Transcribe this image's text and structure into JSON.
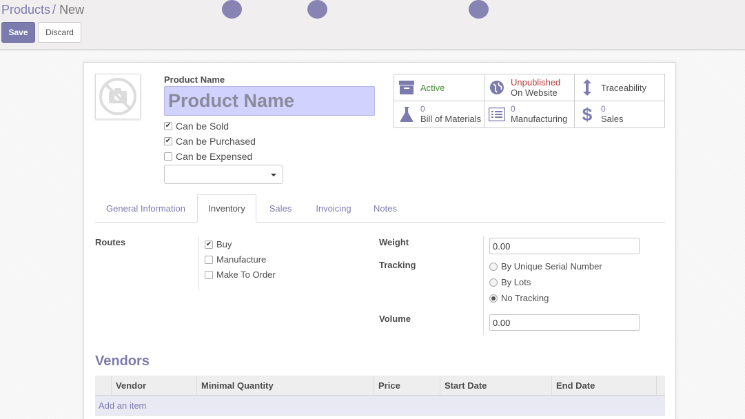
{
  "breadcrumb": {
    "parent": "Products",
    "separator": "/",
    "current": "New"
  },
  "toolbar": {
    "save_label": "Save",
    "discard_label": "Discard"
  },
  "product": {
    "name_label": "Product Name",
    "name_placeholder": "Product Name",
    "flags": [
      {
        "label": "Can be Sold",
        "checked": true
      },
      {
        "label": "Can be Purchased",
        "checked": true
      },
      {
        "label": "Can be Expensed",
        "checked": false
      }
    ],
    "category_select_value": ""
  },
  "stat_buttons": [
    {
      "icon": "archive-icon",
      "label": "Active",
      "color": "#4d8f3c"
    },
    {
      "icon": "globe-icon",
      "label": "Unpublished",
      "sublabel": "On Website",
      "color": "#b43c3c"
    },
    {
      "icon": "arrows-vertical-icon",
      "label": "Traceability"
    },
    {
      "icon": "flask-icon",
      "count": "0",
      "label": "Bill of Materials"
    },
    {
      "icon": "list-icon",
      "count": "0",
      "label": "Manufacturing"
    },
    {
      "icon": "dollar-icon",
      "count": "0",
      "label": "Sales"
    }
  ],
  "tabs": [
    {
      "label": "General Information",
      "active": false
    },
    {
      "label": "Inventory",
      "active": true
    },
    {
      "label": "Sales",
      "active": false
    },
    {
      "label": "Invoicing",
      "active": false
    },
    {
      "label": "Notes",
      "active": false
    }
  ],
  "inventory": {
    "routes_label": "Routes",
    "routes": [
      {
        "label": "Buy",
        "checked": true
      },
      {
        "label": "Manufacture",
        "checked": false
      },
      {
        "label": "Make To Order",
        "checked": false
      }
    ],
    "weight_label": "Weight",
    "weight_value": "0.00",
    "tracking_label": "Tracking",
    "tracking_options": [
      {
        "label": "By Unique Serial Number",
        "selected": false
      },
      {
        "label": "By Lots",
        "selected": false
      },
      {
        "label": "No Tracking",
        "selected": true
      }
    ],
    "volume_label": "Volume",
    "volume_value": "0.00"
  },
  "vendors": {
    "title": "Vendors",
    "columns": [
      "Vendor",
      "Minimal Quantity",
      "Price",
      "Start Date",
      "End Date"
    ],
    "add_item_label": "Add an item"
  },
  "colors": {
    "accent": "#7c7bad",
    "name_field_bg": "#d2d2ff"
  }
}
